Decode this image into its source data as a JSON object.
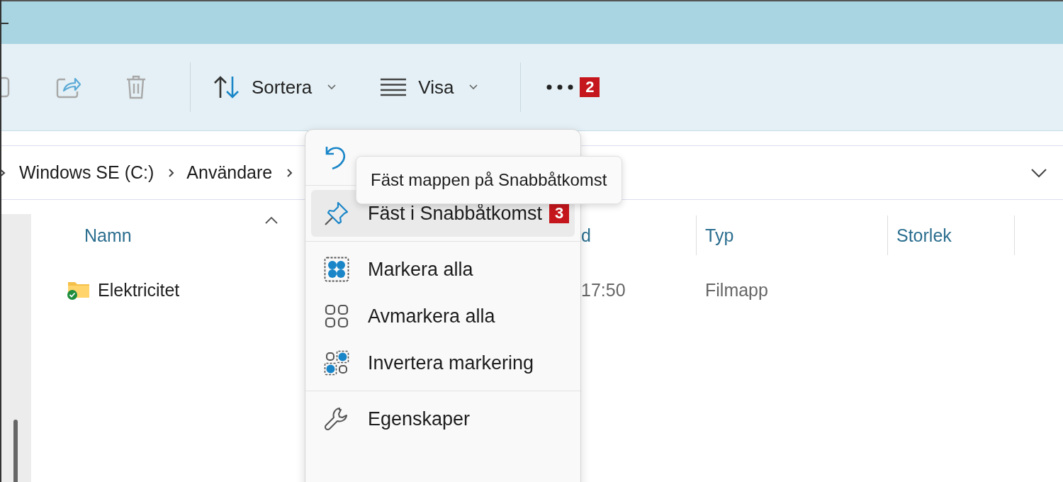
{
  "toolbar": {
    "icon_buttons": [
      {
        "kind": "copy",
        "disabled": true
      },
      {
        "kind": "share",
        "disabled": true
      },
      {
        "kind": "trash",
        "disabled": true
      }
    ],
    "sort_button": {
      "label": "Sortera"
    },
    "view_button": {
      "label": "Visa"
    },
    "more_button": {
      "badge": "2"
    }
  },
  "address_bar": {
    "crumbs": [
      "Windows SE (C:)",
      "Användare"
    ]
  },
  "table": {
    "sort_ascending": true,
    "columns": [
      {
        "label": "Namn"
      },
      {
        "label": "d"
      },
      {
        "label": "Typ"
      },
      {
        "label": "Storlek"
      }
    ],
    "rows": [
      {
        "cells": [
          "Elektricitet",
          "17:50",
          "Filmapp",
          ""
        ],
        "synced": true
      }
    ]
  },
  "menu": {
    "items": [
      {
        "kind": "undo",
        "selected": false
      },
      {
        "kind": "pin",
        "label": "Fäst i Snabbåtkomst",
        "selected": true,
        "badge": "3"
      },
      {
        "kind": "select_all",
        "label": "Markera alla",
        "selected": false
      },
      {
        "kind": "select_none",
        "label": "Avmarkera alla",
        "selected": false
      },
      {
        "kind": "invert",
        "label": "Invertera markering",
        "selected": false
      },
      {
        "kind": "properties",
        "label": "Egenskaper",
        "selected": false
      }
    ]
  },
  "tooltip": {
    "text": "Fäst mappen på Snabbåtkomst"
  }
}
